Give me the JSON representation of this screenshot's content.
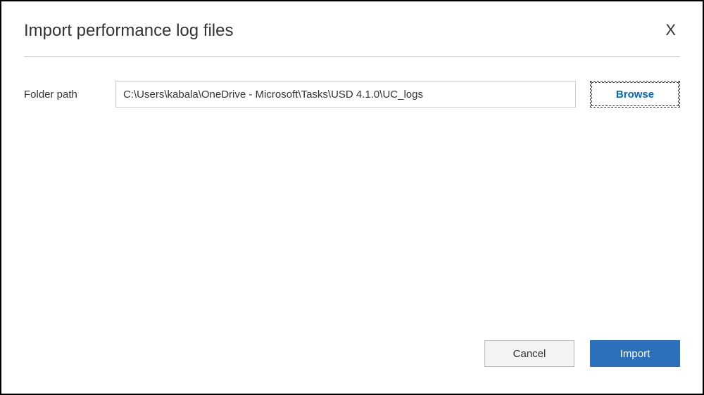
{
  "dialog": {
    "title": "Import performance log files",
    "close_label": "X"
  },
  "form": {
    "folder_path_label": "Folder path",
    "folder_path_value": "C:\\Users\\kabala\\OneDrive - Microsoft\\Tasks\\USD 4.1.0\\UC_logs",
    "browse_label": "Browse"
  },
  "actions": {
    "cancel_label": "Cancel",
    "import_label": "Import"
  }
}
